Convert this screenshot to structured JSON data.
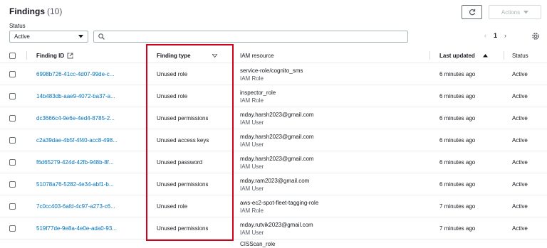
{
  "header": {
    "title": "Findings",
    "count": "(10)"
  },
  "toolbar": {
    "actions_label": "Actions"
  },
  "filter": {
    "status_label": "Status",
    "status_value": "Active",
    "search_placeholder": ""
  },
  "pagination": {
    "prev": "‹",
    "page": "1",
    "next": "›"
  },
  "columns": {
    "finding_id": "Finding ID",
    "finding_type": "Finding type",
    "iam_resource": "IAM resource",
    "last_updated": "Last updated",
    "status": "Status"
  },
  "rows": [
    {
      "id": "6998b726-41cc-4d07-99de-c...",
      "type": "Unused role",
      "resource": "service-role/cognito_sms",
      "resource_type": "IAM Role",
      "updated": "6 minutes ago",
      "status": "Active"
    },
    {
      "id": "14b483db-aae9-4072-ba37-a...",
      "type": "Unused role",
      "resource": "inspector_role",
      "resource_type": "IAM Role",
      "updated": "6 minutes ago",
      "status": "Active"
    },
    {
      "id": "dc3666c4-9e6e-4ed4-8785-2...",
      "type": "Unused permissions",
      "resource": "mday.harsh2023@gmail.com",
      "resource_type": "IAM User",
      "updated": "6 minutes ago",
      "status": "Active"
    },
    {
      "id": "c2a39dae-4b5f-4f40-acc8-498...",
      "type": "Unused access keys",
      "resource": "mday.harsh2023@gmail.com",
      "resource_type": "IAM User",
      "updated": "6 minutes ago",
      "status": "Active"
    },
    {
      "id": "f6d65279-424d-42fb-948b-8f...",
      "type": "Unused password",
      "resource": "mday.harsh2023@gmail.com",
      "resource_type": "IAM User",
      "updated": "6 minutes ago",
      "status": "Active"
    },
    {
      "id": "51078a76-5282-4e34-abf1-b...",
      "type": "Unused permissions",
      "resource": "mday.ram2023@gmail.com",
      "resource_type": "IAM User",
      "updated": "6 minutes ago",
      "status": "Active"
    },
    {
      "id": "7c0cc403-6afd-4c97-a273-c6...",
      "type": "Unused role",
      "resource": "aws-ec2-spot-fleet-tagging-role",
      "resource_type": "IAM Role",
      "updated": "7 minutes ago",
      "status": "Active"
    },
    {
      "id": "519f77de-9e8a-4e0e-ada0-93...",
      "type": "Unused permissions",
      "resource": "mday.rutvik2023@gmail.com",
      "resource_type": "IAM User",
      "updated": "7 minutes ago",
      "status": "Active"
    }
  ],
  "partial_row": {
    "resource": "CISScan_role"
  },
  "colors": {
    "link": "#0073bb",
    "highlight": "#d0021b",
    "border": "#eaeded"
  }
}
